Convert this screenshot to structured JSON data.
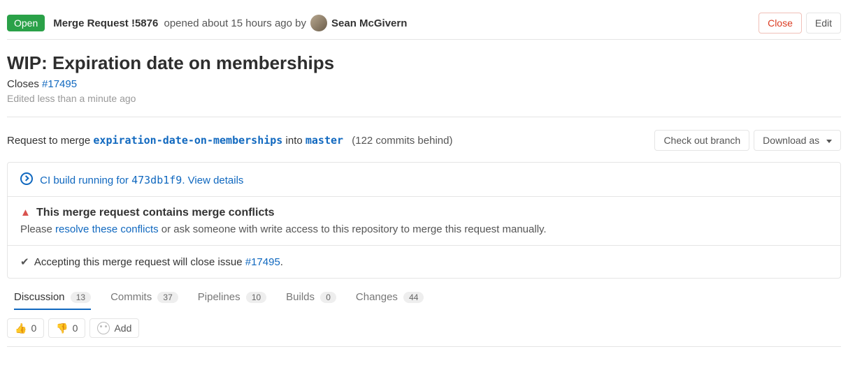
{
  "header": {
    "status": "Open",
    "type": "Merge Request",
    "id": "!5876",
    "opened_text": "opened about 15 hours ago by",
    "author": "Sean McGivern",
    "close_label": "Close",
    "edit_label": "Edit"
  },
  "title": "WIP: Expiration date on memberships",
  "closes_prefix": "Closes ",
  "closes_issue": "#17495",
  "edited": "Edited less than a minute ago",
  "merge": {
    "request_text": "Request to merge ",
    "source_branch": "expiration-date-on-memberships",
    "into_text": " into ",
    "target_branch": "master",
    "behind": "(122 commits behind)",
    "checkout_label": "Check out branch",
    "download_label": "Download as"
  },
  "ci": {
    "prefix": "CI build running for ",
    "sha": "473db1f9",
    "suffix": ". View details"
  },
  "conflicts": {
    "title": "This merge request contains merge conflicts",
    "please": "Please ",
    "resolve_link": "resolve these conflicts",
    "rest": " or ask someone with write access to this repository to merge this request manually."
  },
  "accept": {
    "prefix": "Accepting this merge request will close issue ",
    "issue": "#17495",
    "suffix": "."
  },
  "tabs": {
    "discussion": {
      "label": "Discussion",
      "count": "13"
    },
    "commits": {
      "label": "Commits",
      "count": "37"
    },
    "pipelines": {
      "label": "Pipelines",
      "count": "10"
    },
    "builds": {
      "label": "Builds",
      "count": "0"
    },
    "changes": {
      "label": "Changes",
      "count": "44"
    }
  },
  "reactions": {
    "thumbs_up": "0",
    "thumbs_down": "0",
    "add_label": "Add"
  }
}
